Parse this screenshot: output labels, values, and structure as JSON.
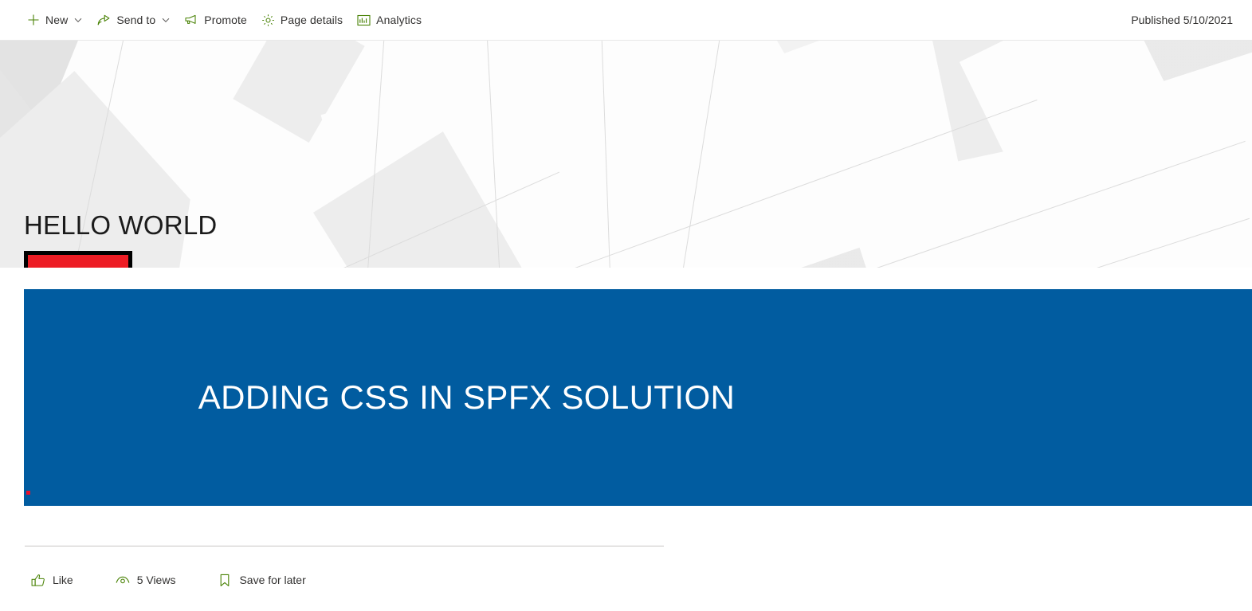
{
  "command_bar": {
    "items": [
      {
        "label": "New",
        "icon": "plus-icon",
        "has_chevron": true
      },
      {
        "label": "Send to",
        "icon": "share-icon",
        "has_chevron": true
      },
      {
        "label": "Promote",
        "icon": "megaphone-icon",
        "has_chevron": false
      },
      {
        "label": "Page details",
        "icon": "gear-icon",
        "has_chevron": false
      },
      {
        "label": "Analytics",
        "icon": "bar-chart-icon",
        "has_chevron": false
      }
    ],
    "status": "Published 5/10/2021"
  },
  "hero": {
    "title": "HELLO WORLD",
    "red_box_color": "#ED1C24",
    "red_box_border_color": "#000000"
  },
  "main": {
    "banner": {
      "text": "ADDING CSS IN SPFX SOLUTION",
      "background_color": "#015CA0",
      "text_color": "#FFFFFF",
      "marker_color": "#E8112D"
    }
  },
  "footer": {
    "actions": [
      {
        "label": "Like",
        "icon": "thumbs-up-icon"
      },
      {
        "label": "5 Views",
        "icon": "eye-icon"
      },
      {
        "label": "Save for later",
        "icon": "bookmark-icon"
      }
    ]
  },
  "theme": {
    "icon_accent": "#498205",
    "text": "#323130"
  }
}
